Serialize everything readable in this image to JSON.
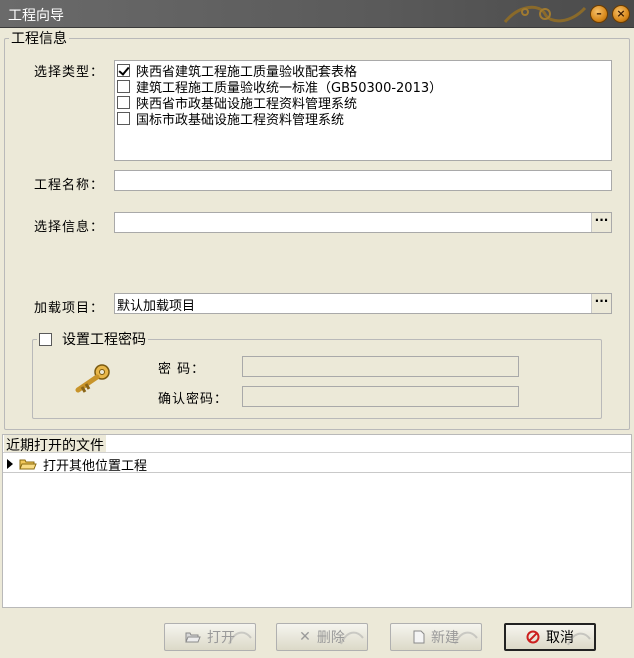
{
  "window": {
    "title": "工程向导"
  },
  "project_info": {
    "legend": "工程信息",
    "type_label": "选择类型：",
    "types": [
      {
        "label": "陕西省建筑工程施工质量验收配套表格",
        "checked": true
      },
      {
        "label": "建筑工程施工质量验收统一标准（GB50300-2013）",
        "checked": false
      },
      {
        "label": "陕西省市政基础设施工程资料管理系统",
        "checked": false
      },
      {
        "label": "国标市政基础设施工程资料管理系统",
        "checked": false
      }
    ],
    "name_label": "工程名称：",
    "name_value": "",
    "select_info_label": "选择信息：",
    "select_info_value": "",
    "load_label": "加载项目：",
    "load_value": "默认加载项目",
    "ellipsis": "···"
  },
  "password": {
    "legend": "设置工程密码",
    "enabled": false,
    "pwd_label": "密      码：",
    "confirm_label": "确认密码："
  },
  "recent": {
    "legend": "近期打开的文件",
    "items": [
      {
        "label": "打开其他位置工程"
      }
    ]
  },
  "buttons": {
    "open": "打开",
    "delete": "删除",
    "new": "新建",
    "cancel": "取消"
  },
  "colors": {
    "accent_orange": "#d98a1c",
    "cancel_red": "#cc1f1f"
  }
}
